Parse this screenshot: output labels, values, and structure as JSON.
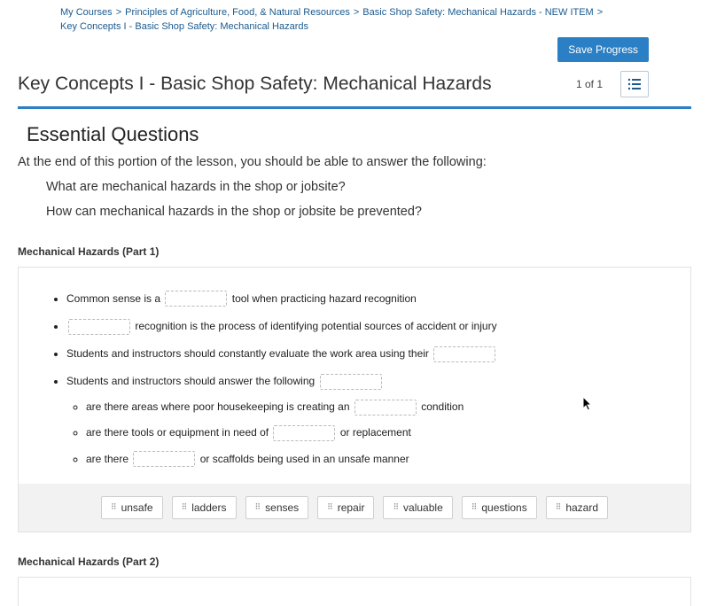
{
  "breadcrumb": {
    "items": [
      {
        "label": "My Courses"
      },
      {
        "label": "Principles of Agriculture, Food, & Natural Resources"
      },
      {
        "label": "Basic Shop Safety: Mechanical Hazards - NEW ITEM"
      }
    ],
    "current": "Key Concepts I - Basic Shop Safety: Mechanical Hazards"
  },
  "actions": {
    "save_label": "Save Progress"
  },
  "header": {
    "title": "Key Concepts I - Basic Shop Safety: Mechanical Hazards",
    "pager": "1 of 1"
  },
  "essential": {
    "heading": "Essential Questions",
    "intro": "At the end of this portion of the lesson, you should be able to answer the following:",
    "questions": [
      "What are mechanical hazards in the shop or jobsite?",
      "How can mechanical hazards in the shop or jobsite be prevented?"
    ]
  },
  "part1": {
    "title": "Mechanical Hazards (Part 1)",
    "bullets": {
      "b1_pre": "Common sense is a ",
      "b1_post": " tool when practicing hazard recognition",
      "b2_post": " recognition is the process of identifying potential sources of accident or injury",
      "b3_pre": "Students and instructors should constantly evaluate the work area using their ",
      "b4_pre": "Students and instructors should answer the following ",
      "s1_pre": "are there areas where poor housekeeping is creating an ",
      "s1_post": " condition",
      "s2_pre": "are there tools or equipment in need of ",
      "s2_post": " or replacement",
      "s3_pre": "are there ",
      "s3_post": " or scaffolds being used in an unsafe manner"
    },
    "wordbank": [
      "unsafe",
      "ladders",
      "senses",
      "repair",
      "valuable",
      "questions",
      "hazard"
    ]
  },
  "part2": {
    "title": "Mechanical Hazards (Part 2)"
  }
}
